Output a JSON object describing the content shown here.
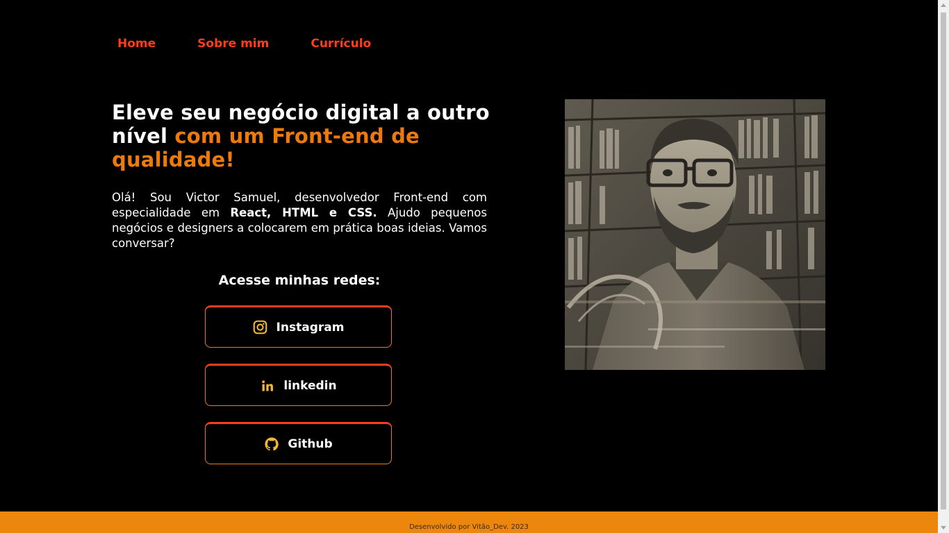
{
  "nav": {
    "items": [
      {
        "label": "Home"
      },
      {
        "label": "Sobre mim"
      },
      {
        "label": "Currículo"
      }
    ]
  },
  "hero": {
    "title_part1": "Eleve seu negócio digital a outro nível ",
    "title_accent": "com um Front-end de qualidade!",
    "intro_part1": "Olá! Sou Victor Samuel, desenvolvedor Front-end com especialidade em ",
    "intro_bold": "React, HTML e CSS.",
    "intro_part2": " Ajudo pequenos negócios e designers a colocarem em prática boas ideias. Vamos conversar?"
  },
  "networks": {
    "title": "Acesse minhas redes:",
    "buttons": [
      {
        "label": "Instagram",
        "icon": "instagram-icon"
      },
      {
        "label": "linkedin",
        "icon": "linkedin-icon"
      },
      {
        "label": "Github",
        "icon": "github-icon"
      }
    ]
  },
  "footer": {
    "text": "Desenvolvido por Vitão_Dev. 2023"
  },
  "colors": {
    "background": "#000000",
    "nav_link": "#ff3d1a",
    "accent": "#ec7a0c",
    "footer_bg": "#ec860c",
    "icon": "#f5b731"
  }
}
